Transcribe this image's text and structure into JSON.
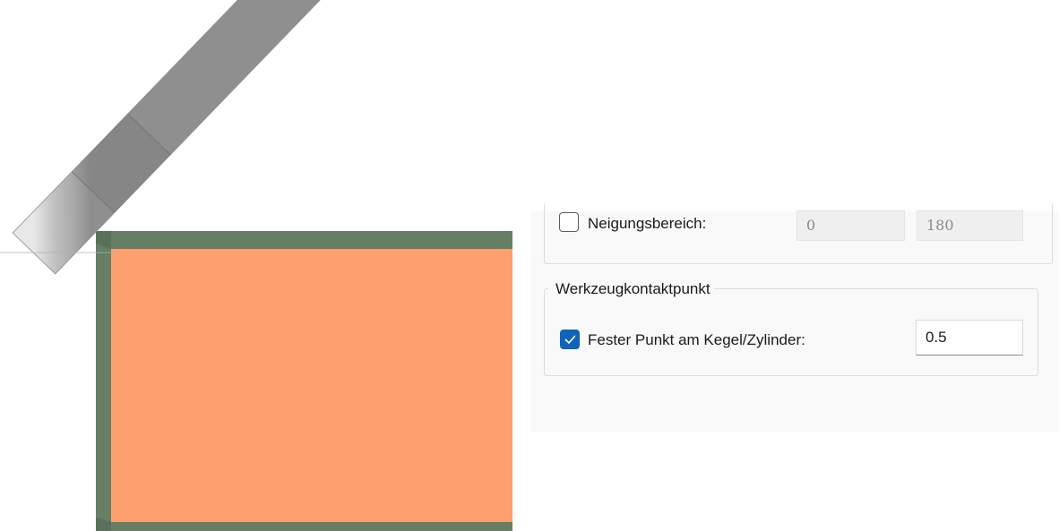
{
  "tilt_range": {
    "label": "Neigungsbereich:",
    "checked": false,
    "min_value": "0",
    "max_value": "180"
  },
  "contact_group": {
    "title": "Werkzeugkontaktpunkt",
    "fixed_point_label": "Fester Punkt am Kegel/Zylinder:",
    "checked": true,
    "value": "0.5"
  },
  "colors": {
    "accent": "#0f63b8",
    "workpiece_fill": "#fe9f6e",
    "workpiece_border": "#657e64",
    "tool_gray": "#b8b8b8"
  }
}
